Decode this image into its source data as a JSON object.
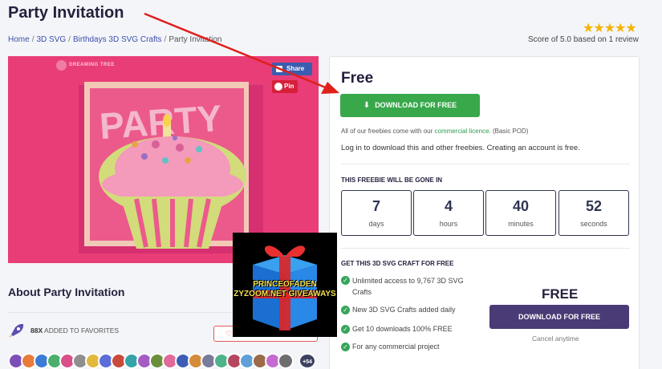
{
  "page": {
    "title": "Party Invitation",
    "breadcrumb": [
      "Home",
      "3D SVG",
      "Birthdays 3D SVG Crafts",
      "Party Invitation"
    ],
    "stars": "★★★★★",
    "score": "Score of 5.0 based on 1 review"
  },
  "image": {
    "brand": "DREAMING TREE",
    "share_label": "Share",
    "pin_label": "Pin",
    "card_text": "PARTY"
  },
  "download": {
    "price": "Free",
    "button_label": "DOWNLOAD FOR FREE",
    "note_prefix": "All of our freebies come with our ",
    "note_link": "commercial licence",
    "note_suffix": ". (Basic POD)",
    "login_note": "Log in to download this and other freebies. Creating an account is free.",
    "gone_title": "THIS FREEBIE WILL BE GONE IN",
    "countdown": [
      {
        "value": "7",
        "unit": "days"
      },
      {
        "value": "4",
        "unit": "hours"
      },
      {
        "value": "40",
        "unit": "minutes"
      },
      {
        "value": "52",
        "unit": "seconds"
      }
    ]
  },
  "offer": {
    "title": "GET THIS 3D SVG CRAFT FOR FREE",
    "features": [
      "Unlimited access to 9,767 3D SVG Crafts",
      "New 3D SVG Crafts added daily",
      "Get 10 downloads 100% FREE",
      "For any commercial project"
    ],
    "price": "FREE",
    "button_label": "DOWNLOAD FOR FREE",
    "cancel": "Cancel anytime"
  },
  "about": {
    "title": "About Party Invitation",
    "fav_count": "88X",
    "fav_label": "ADDED TO FAVORITES",
    "avatar_more": "+54"
  },
  "overlay": {
    "giveaway_text": "PRINCEOFADEN ZYZOOM.NET GIVEAWAYS"
  },
  "colors": {
    "accent_green": "#38a84b",
    "accent_purple": "#4a3a75",
    "arrow_red": "#e0201a",
    "card_pink": "#e93d77",
    "star_gold": "#f5b301"
  }
}
